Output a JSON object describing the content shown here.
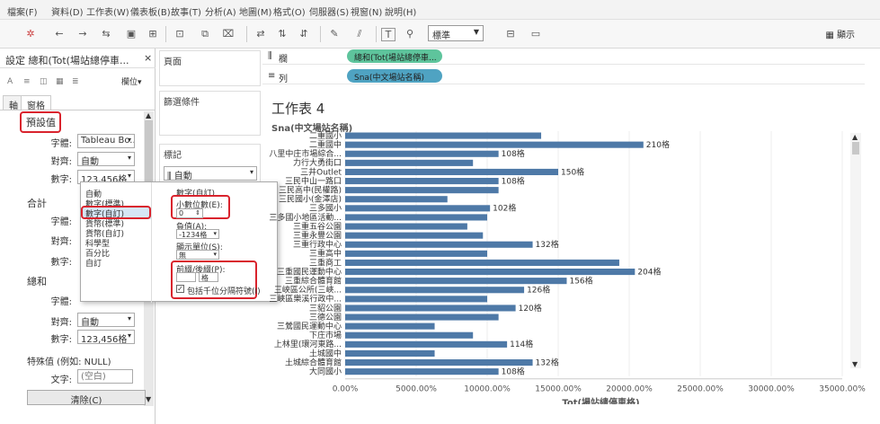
{
  "menu": [
    "檔案(F)",
    "資料(D)",
    "工作表(W)",
    "儀表板(B)",
    "故事(T)",
    "分析(A)",
    "地圖(M)",
    "格式(O)",
    "伺服器(S)",
    "視窗(N)",
    "說明(H)"
  ],
  "toolbar": {
    "format_select": "標準",
    "present": "顯示"
  },
  "format_pane": {
    "title": "設定 總和(Tot(場站總停車...",
    "fields_btn": "欄位▾",
    "tabs": [
      "軸",
      "窗格"
    ],
    "sections": {
      "default": "預設值",
      "total": "合計",
      "sum": "總和",
      "special": "特殊值 (例如: NULL)"
    },
    "labels": {
      "font": "字體:",
      "align": "對齊:",
      "number": "數字:",
      "text": "文字:"
    },
    "default_font": "Tableau Bo...",
    "default_align": "自動",
    "default_number": "123,456格",
    "sum_align": "自動",
    "sum_number": "123,456格",
    "special_text_placeholder": "(空白)",
    "clear_button": "清除(C)"
  },
  "number_popup": {
    "options": [
      "自動",
      "數字(標準)",
      "數字(自訂)",
      "貨幣(標準)",
      "貨幣(自訂)",
      "科學型",
      "百分比",
      "自訂"
    ],
    "selected": "數字(自訂)",
    "header": "數字(自訂)",
    "decimals_label": "小數位數(E):",
    "decimals_value": "0",
    "negative_label": "負值(A):",
    "negative_value": "-1234格",
    "units_label": "顯示單位(S):",
    "units_value": "無",
    "prefix_label": "前綴/後綴(P):",
    "prefix_value": "",
    "suffix_value": "格",
    "thousands_label": "包括千位分隔符號(I)"
  },
  "shelves": {
    "pages": "頁面",
    "filters": "篩選條件",
    "marks": "標記",
    "marks_type": "自動"
  },
  "columns_shelf": {
    "label": "欄",
    "pill": "總和(Tot(場站總停車..."
  },
  "rows_shelf": {
    "label": "列",
    "pill": "Sna(中文場站名稱)"
  },
  "sheet_title": "工作表 4",
  "colors": {
    "bar": "#4e79a7",
    "col_pill": "#5ec49c",
    "row_pill": "#4fa3c2",
    "highlight": "#d9232d"
  },
  "chart_data": {
    "type": "bar",
    "orientation": "horizontal",
    "ylabel": "Sna(中文場站名稱)",
    "xlabel": "Tot(場站總停車格)",
    "xticks": [
      "0.00%",
      "5000.00%",
      "10000.00%",
      "15000.00%",
      "20000.00%",
      "25000.00%",
      "30000.00%",
      "35000.00%"
    ],
    "xlim": [
      0,
      350
    ],
    "categories": [
      "二重國小",
      "二重國中",
      "八里中庄市場綜合...",
      "力行大勇街口",
      "三井Outlet",
      "三民中山一路口",
      "三民高中(民權路)",
      "三民國小(金澤店)",
      "三多國小",
      "三多國小地區活動...",
      "三重五谷公園",
      "三重永豐公園",
      "三重行政中心",
      "三重高中",
      "三重商工",
      "三重國民運動中心",
      "三重綜合體育館",
      "三峽區公所(三峽...",
      "三峽區樂溪行政中...",
      "三貂公園",
      "三德公園",
      "三鶯國民運動中心",
      "下庄市場",
      "上林里(環河東路...",
      "土城國中",
      "土城綜合體育館",
      "大同國小"
    ],
    "values": [
      138,
      210,
      108,
      90,
      150,
      108,
      108,
      72,
      102,
      100,
      86,
      97,
      132,
      100,
      193,
      204,
      156,
      126,
      100,
      120,
      108,
      63,
      90,
      114,
      63,
      132,
      108
    ],
    "data_labels": [
      "",
      "210格",
      "108格",
      "",
      "150格",
      "108格",
      "",
      "",
      "102格",
      "",
      "",
      "",
      "132格",
      "",
      "",
      "204格",
      "156格",
      "126格",
      "",
      "120格",
      "",
      "",
      "",
      "114格",
      "",
      "132格",
      "108格"
    ]
  }
}
